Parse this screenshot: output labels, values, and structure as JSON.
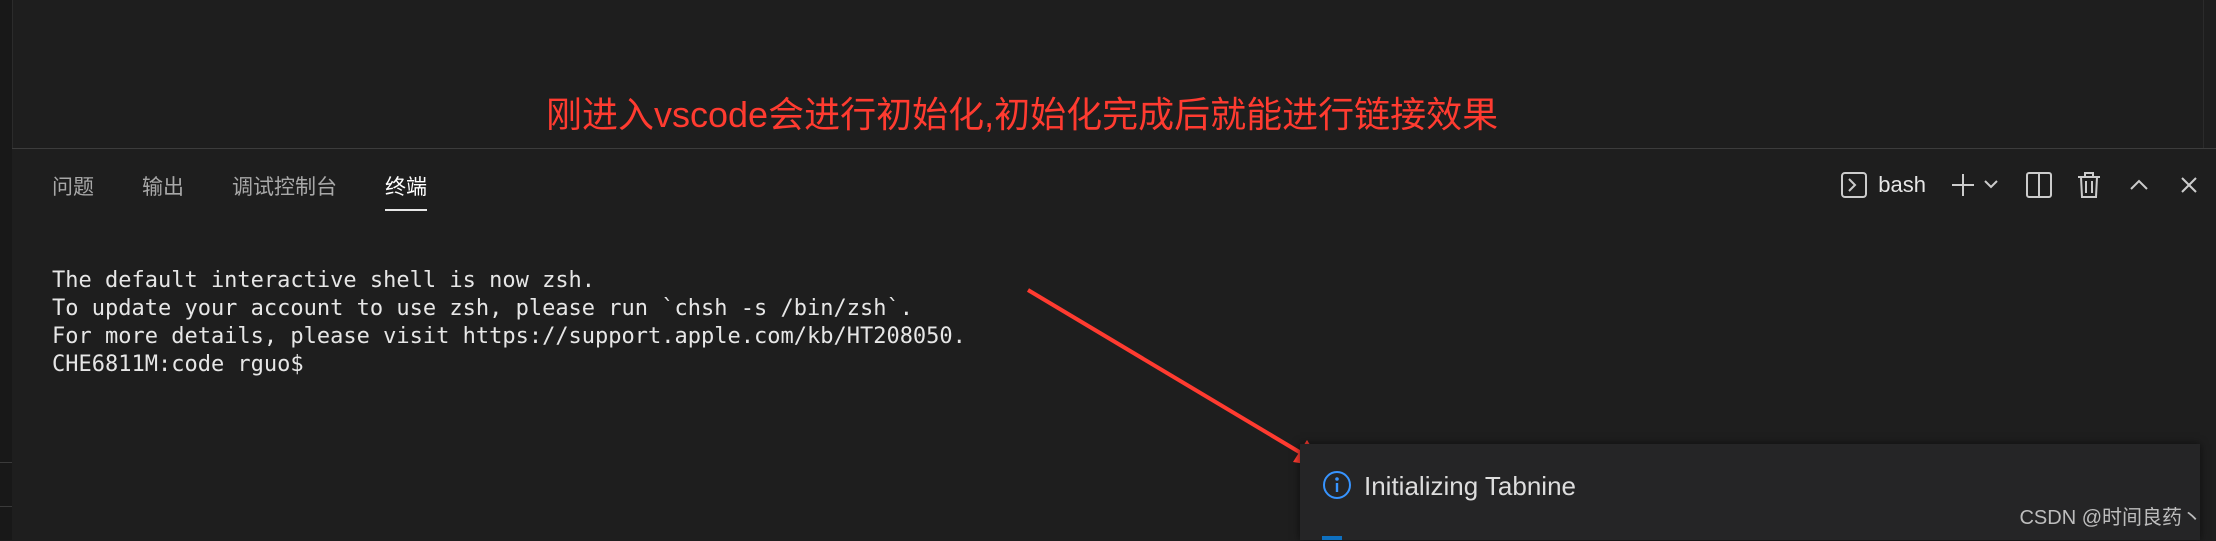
{
  "panel": {
    "tabs": [
      {
        "label": "问题",
        "active": false
      },
      {
        "label": "输出",
        "active": false
      },
      {
        "label": "调试控制台",
        "active": false
      },
      {
        "label": "终端",
        "active": true
      }
    ],
    "terminal_picker": {
      "label": "bash",
      "icon": "terminal-icon"
    },
    "action_icons": [
      "plus-icon",
      "chevron-down-icon",
      "split-icon",
      "trash-icon",
      "chevron-up-icon",
      "close-icon"
    ]
  },
  "terminal": {
    "lines": [
      "The default interactive shell is now zsh.",
      "To update your account to use zsh, please run `chsh -s /bin/zsh`.",
      "For more details, please visit https://support.apple.com/kb/HT208050.",
      "CHE6811M:code rguo$"
    ]
  },
  "annotation": {
    "text": "刚进入vscode会进行初始化,初始化完成后就能进行链接效果",
    "color": "#ff3b30"
  },
  "notification": {
    "icon": "info-icon",
    "message": "Initializing Tabnine",
    "accent": "#0e70c0"
  },
  "watermark": "CSDN @时间良药丶"
}
